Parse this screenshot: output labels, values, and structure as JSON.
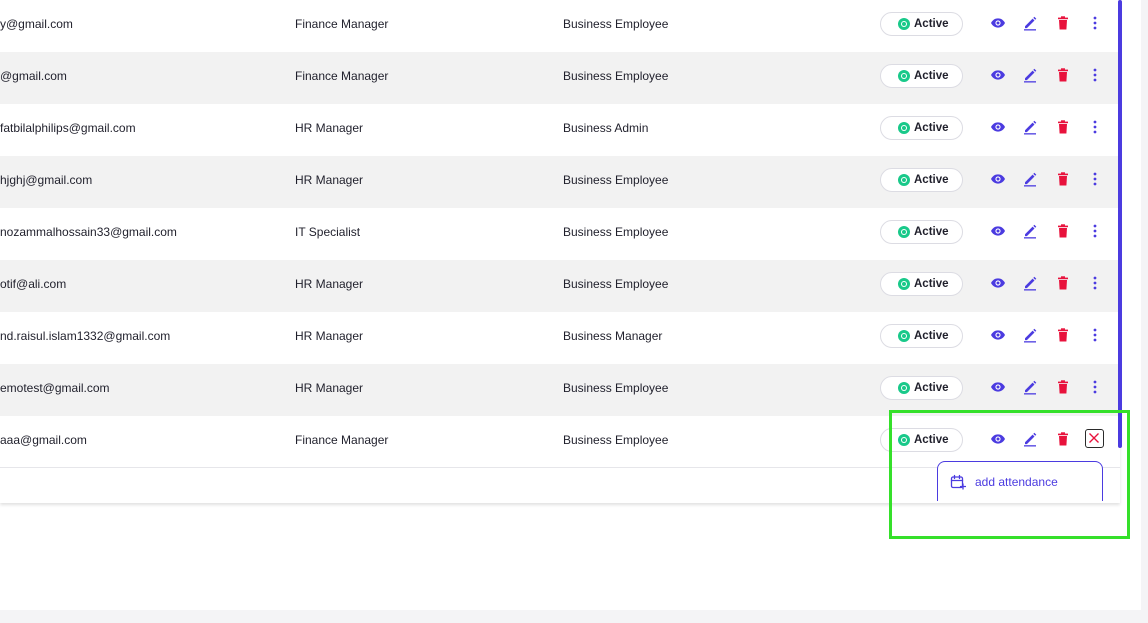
{
  "table": {
    "rows": [
      {
        "email": "y@gmail.com",
        "role": "Finance Manager",
        "type": "Business Employee",
        "status": "Active"
      },
      {
        "email": "@gmail.com",
        "role": "Finance Manager",
        "type": "Business Employee",
        "status": "Active"
      },
      {
        "email": "fatbilalphilips@gmail.com",
        "role": "HR Manager",
        "type": "Business Admin",
        "status": "Active"
      },
      {
        "email": "hjghj@gmail.com",
        "role": "HR Manager",
        "type": "Business Employee",
        "status": "Active"
      },
      {
        "email": "nozammalhossain33@gmail.com",
        "role": "IT Specialist",
        "type": "Business Employee",
        "status": "Active"
      },
      {
        "email": "otif@ali.com",
        "role": "HR Manager",
        "type": "Business Employee",
        "status": "Active"
      },
      {
        "email": "nd.raisul.islam1332@gmail.com",
        "role": "HR Manager",
        "type": "Business Manager",
        "status": "Active"
      },
      {
        "email": "emotest@gmail.com",
        "role": "HR Manager",
        "type": "Business Employee",
        "status": "Active"
      },
      {
        "email": "aaa@gmail.com",
        "role": "Finance Manager",
        "type": "Business Employee",
        "status": "Active"
      }
    ]
  },
  "icons": {
    "view": "eye-icon",
    "edit": "pencil-icon",
    "delete": "trash-icon",
    "more": "more-vertical-icon",
    "close": "close-icon",
    "attendance": "calendar-plus-icon",
    "status": "status-dot-icon"
  },
  "menu": {
    "add_attendance_label": "add attendance"
  },
  "colors": {
    "accent": "#4b3be0",
    "danger": "#e8123c",
    "success": "#19c98a",
    "highlight": "#35e02a"
  }
}
